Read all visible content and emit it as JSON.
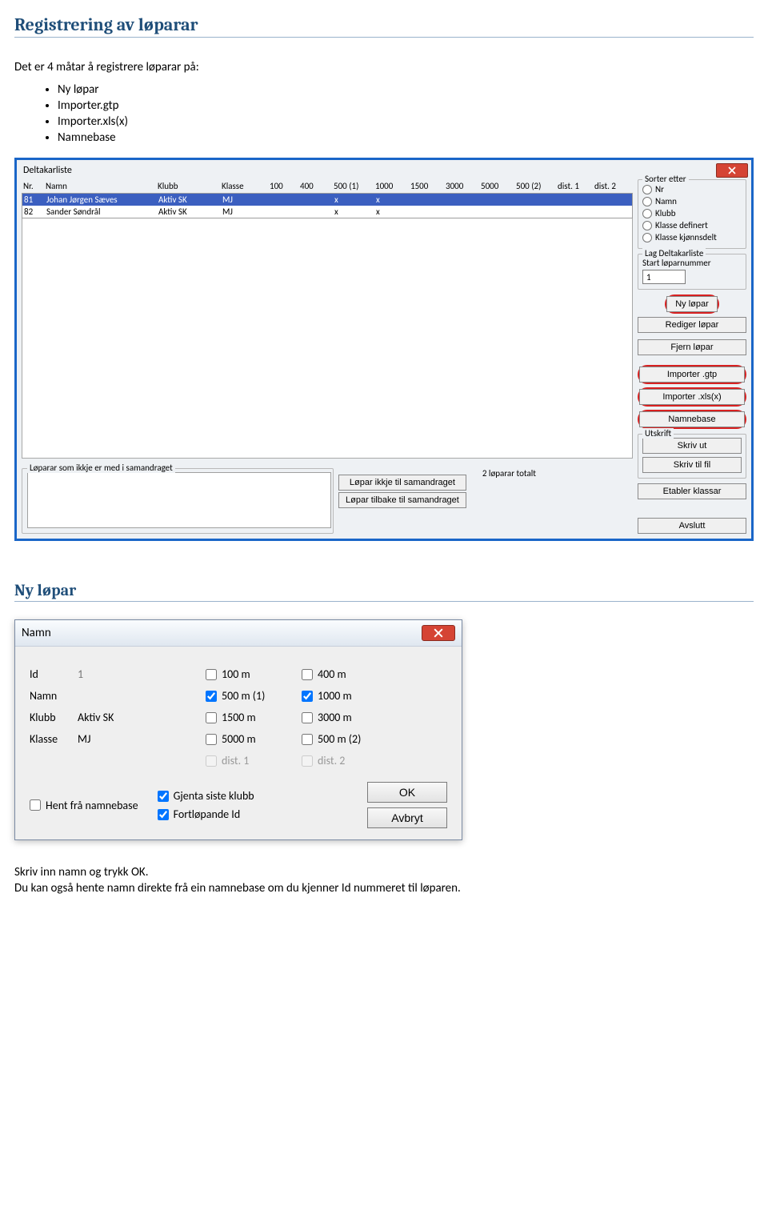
{
  "doc": {
    "h1": "Registrering av løparar",
    "intro": "Det er 4 måtar å registrere løparar på:",
    "bullets": [
      "Ny løpar",
      "Importer.gtp",
      "Importer.xls(x)",
      "Namnebase"
    ],
    "h2": "Ny løpar",
    "outro1": "Skriv inn namn og trykk OK.",
    "outro2": "Du kan også hente namn direkte frå ein namnebase om du kjenner Id nummeret til løparen."
  },
  "win": {
    "title": "Deltakarliste",
    "columns": [
      "Nr.",
      "Namn",
      "Klubb",
      "Klasse",
      "100",
      "400",
      "500 (1)",
      "1000",
      "1500",
      "3000",
      "5000",
      "500 (2)",
      "dist. 1",
      "dist. 2"
    ],
    "rows": [
      {
        "nr": "81",
        "namn": "Johan Jørgen Sæves",
        "klubb": "Aktiv SK",
        "klasse": "MJ",
        "c100": "",
        "c400": "",
        "c500_1": "x",
        "c1000": "x",
        "c1500": "",
        "c3000": "",
        "c5000": "",
        "c500_2": "",
        "d1": "",
        "d2": ""
      },
      {
        "nr": "82",
        "namn": "Sander Søndrål",
        "klubb": "Aktiv SK",
        "klasse": "MJ",
        "c100": "",
        "c400": "",
        "c500_1": "x",
        "c1000": "x",
        "c1500": "",
        "c3000": "",
        "c5000": "",
        "c500_2": "",
        "d1": "",
        "d2": ""
      }
    ],
    "sorter": {
      "legend": "Sorter etter",
      "options": [
        "Nr",
        "Namn",
        "Klubb",
        "Klasse definert",
        "Klasse kjønnsdelt"
      ]
    },
    "lag": {
      "legend": "Lag Deltakarliste",
      "startLabel": "Start løparnummer",
      "startValue": "1"
    },
    "buttons": {
      "nyLopar": "Ny løpar",
      "rediger": "Rediger løpar",
      "fjern": "Fjern løpar",
      "impGtp": "Importer .gtp",
      "impXls": "Importer .xls(x)",
      "namnebase": "Namnebase",
      "utskriftLegend": "Utskrift",
      "skrivUt": "Skriv ut",
      "skrivFil": "Skriv til fil",
      "etabler": "Etabler klassar",
      "avslutt": "Avslutt"
    },
    "bottom": {
      "legend": "Løparar som ikkje er med i samandraget",
      "ikkje": "Løpar ikkje til samandraget",
      "tilbake": "Løpar tilbake til samandraget",
      "totalt": "2 løparar totalt"
    }
  },
  "dlg": {
    "title": "Namn",
    "labels": {
      "id": "Id",
      "namn": "Namn",
      "klubb": "Klubb",
      "klasse": "Klasse"
    },
    "values": {
      "id": "1",
      "namn": "",
      "klubb": "Aktiv SK",
      "klasse": "MJ"
    },
    "dist": {
      "100": "100 m",
      "400": "400 m",
      "500_1": "500 m (1)",
      "1000": "1000 m",
      "1500": "1500 m",
      "3000": "3000 m",
      "5000": "5000 m",
      "500_2": "500 m (2)",
      "d1": "dist. 1",
      "d2": "dist. 2"
    },
    "checks": {
      "hent": "Hent frå namnebase",
      "gjenta": "Gjenta siste klubb",
      "fortl": "Fortløpande Id"
    },
    "buttons": {
      "ok": "OK",
      "avbryt": "Avbryt"
    }
  }
}
